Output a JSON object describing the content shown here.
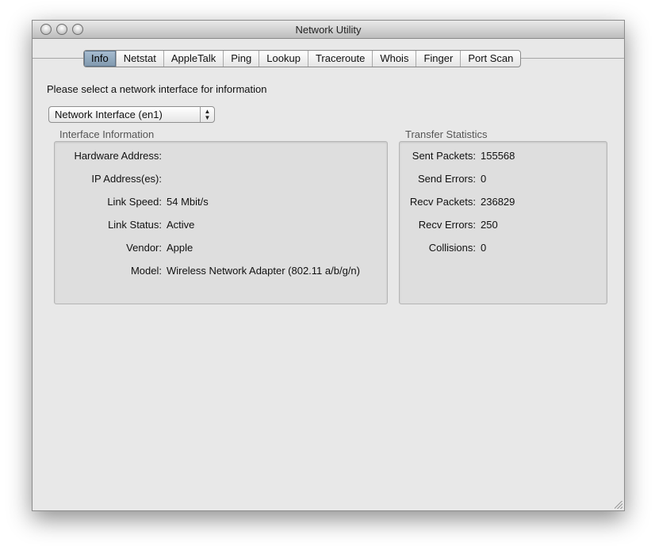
{
  "window": {
    "title": "Network Utility"
  },
  "tabs": [
    "Info",
    "Netstat",
    "AppleTalk",
    "Ping",
    "Lookup",
    "Traceroute",
    "Whois",
    "Finger",
    "Port Scan"
  ],
  "active_tab": "Info",
  "prompt": "Please select a network interface for information",
  "interface_select": {
    "value": "Network Interface (en1)"
  },
  "interface_info": {
    "title": "Interface Information",
    "rows": [
      {
        "label": "Hardware Address:",
        "value": ""
      },
      {
        "label": "IP Address(es):",
        "value": ""
      },
      {
        "label": "Link Speed:",
        "value": "54 Mbit/s"
      },
      {
        "label": "Link Status:",
        "value": "Active"
      },
      {
        "label": "Vendor:",
        "value": "Apple"
      },
      {
        "label": "Model:",
        "value": "Wireless Network Adapter (802.11 a/b/g/n)"
      }
    ]
  },
  "transfer_stats": {
    "title": "Transfer Statistics",
    "rows": [
      {
        "label": "Sent Packets:",
        "value": "155568"
      },
      {
        "label": "Send Errors:",
        "value": "0"
      },
      {
        "label": "Recv Packets:",
        "value": "236829"
      },
      {
        "label": "Recv Errors:",
        "value": "250"
      },
      {
        "label": "Collisions:",
        "value": "0"
      }
    ]
  }
}
